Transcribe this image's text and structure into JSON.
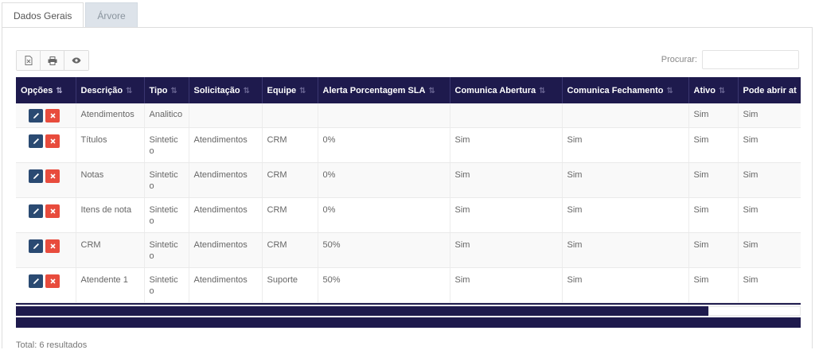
{
  "tabs": [
    {
      "label": "Dados Gerais",
      "active": true
    },
    {
      "label": "Árvore",
      "active": false
    }
  ],
  "toolbar": {
    "buttons": [
      {
        "icon": "excel-export-icon"
      },
      {
        "icon": "print-icon"
      },
      {
        "icon": "eye-icon"
      }
    ]
  },
  "search": {
    "label": "Procurar:",
    "value": "",
    "placeholder": ""
  },
  "table": {
    "columns": [
      "Opções",
      "Descrição",
      "Tipo",
      "Solicitação",
      "Equipe",
      "Alerta Porcentagem SLA",
      "Comunica Abertura",
      "Comunica Fechamento",
      "Ativo",
      "Pode abrir at"
    ],
    "rows": [
      [
        "Atendimentos",
        "Analitico",
        "",
        "",
        "",
        "",
        "",
        "Sim",
        "Sim"
      ],
      [
        "Títulos",
        "Sintetic o",
        "Atendimentos",
        "CRM",
        "0%",
        "Sim",
        "Sim",
        "Sim",
        "Sim"
      ],
      [
        "Notas",
        "Sintetic o",
        "Atendimentos",
        "CRM",
        "0%",
        "Sim",
        "Sim",
        "Sim",
        "Sim"
      ],
      [
        "Itens de nota",
        "Sintetic o",
        "Atendimentos",
        "CRM",
        "0%",
        "Sim",
        "Sim",
        "Sim",
        "Sim"
      ],
      [
        "CRM",
        "Sintetic o",
        "Atendimentos",
        "CRM",
        "50%",
        "Sim",
        "Sim",
        "Sim",
        "Sim"
      ],
      [
        "Atendente 1",
        "Sintetic o",
        "Atendimentos",
        "Suporte",
        "50%",
        "Sim",
        "Sim",
        "Sim",
        "Sim"
      ]
    ]
  },
  "scrollbar": {
    "position_fraction": 0.88
  },
  "footer": {
    "total": "Total: 6 resultados"
  },
  "colors": {
    "header_bg": "#1e1a4d",
    "edit_btn": "#2a4a72",
    "delete_btn": "#e84c3d"
  }
}
